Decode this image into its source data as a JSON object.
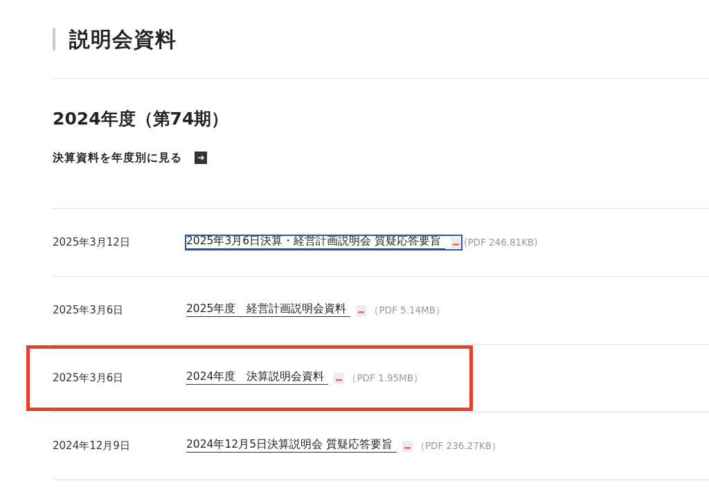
{
  "section_title": "説明会資料",
  "fiscal_year_heading": "2024年度（第74期）",
  "archive_link": {
    "label": "決算資料を年度別に見る"
  },
  "documents": [
    {
      "date": "2025年3月12日",
      "title": "2025年3月6日決算・経営計画説明会 質疑応答要旨",
      "file_info": "(PDF 246.81KB)",
      "focused": true,
      "highlighted": false
    },
    {
      "date": "2025年3月6日",
      "title": "2025年度　経営計画説明会資料",
      "file_info": "（PDF 5.14MB）",
      "focused": false,
      "highlighted": false
    },
    {
      "date": "2025年3月6日",
      "title": "2024年度　決算説明会資料",
      "file_info": "（PDF 1.95MB）",
      "focused": false,
      "highlighted": true
    },
    {
      "date": "2024年12月9日",
      "title": "2024年12月5日決算説明会 質疑応答要旨",
      "file_info": "（PDF 236.27KB）",
      "focused": false,
      "highlighted": false
    }
  ]
}
